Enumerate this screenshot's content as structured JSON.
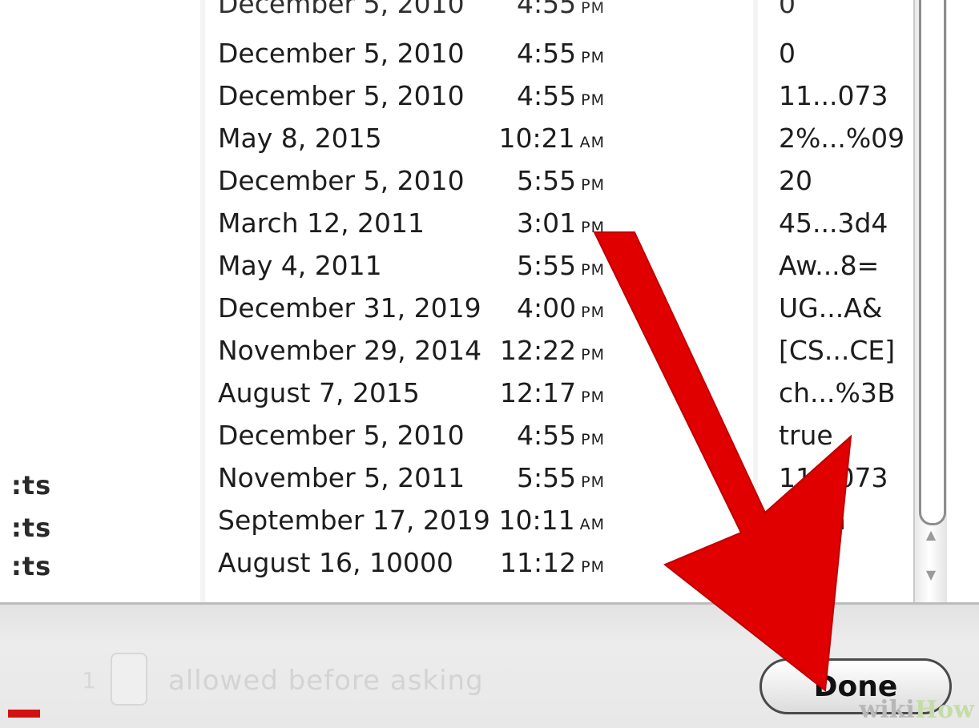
{
  "left_column": {
    "cells": [
      ":ts",
      ":ts",
      ":ts"
    ]
  },
  "rows": [
    {
      "date": "December 5, 2010",
      "time": "4:55",
      "ampm": "PM",
      "value": "0",
      "partial": true
    },
    {
      "date": "December 5, 2010",
      "time": "4:55",
      "ampm": "PM",
      "value": "0"
    },
    {
      "date": "December 5, 2010",
      "time": "4:55",
      "ampm": "PM",
      "value": "11...073"
    },
    {
      "date": "May 8, 2015",
      "time": "10:21",
      "ampm": "AM",
      "value": "2%...%09"
    },
    {
      "date": "December 5, 2010",
      "time": "5:55",
      "ampm": "PM",
      "value": "20"
    },
    {
      "date": "March 12, 2011",
      "time": "3:01",
      "ampm": "PM",
      "value": "45...3d4"
    },
    {
      "date": "May 4, 2011",
      "time": "5:55",
      "ampm": "PM",
      "value": "Aw...8="
    },
    {
      "date": "December 31, 2019",
      "time": "4:00",
      "ampm": "PM",
      "value": "UG...A&"
    },
    {
      "date": "November 29, 2014",
      "time": "12:22",
      "ampm": "PM",
      "value": "[CS...CE]"
    },
    {
      "date": "August 7, 2015",
      "time": "12:17",
      "ampm": "PM",
      "value": "ch...%3B"
    },
    {
      "date": "December 5, 2010",
      "time": "4:55",
      "ampm": "PM",
      "value": "true"
    },
    {
      "date": "November 5, 2011",
      "time": "5:55",
      "ampm": "PM",
      "value": "11...073"
    },
    {
      "date": "September 17, 2019",
      "time": "10:11",
      "ampm": "AM",
      "value": "...om"
    },
    {
      "date": "August 16, 10000",
      "time": "11:12",
      "ampm": "PM",
      "value": "e"
    }
  ],
  "footer": {
    "stepper_value": "1",
    "allowed_label": "allowed before asking",
    "done_label": "Done",
    "watermark_wiki": "wiki",
    "watermark_how": "How"
  },
  "icons": {
    "scroll_up": "scroll-up-arrow-icon",
    "scroll_down": "scroll-down-arrow-icon",
    "pointer": "red-arrow-icon"
  },
  "colors": {
    "arrow": "#e00000",
    "text": "#1d1d1d"
  }
}
